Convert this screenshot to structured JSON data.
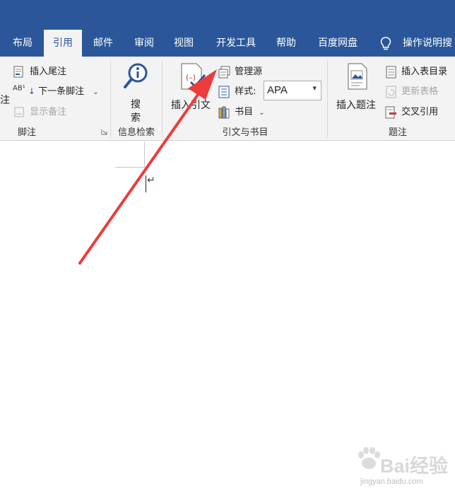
{
  "tabs": [
    {
      "label": "布局"
    },
    {
      "label": "引用"
    },
    {
      "label": "邮件"
    },
    {
      "label": "审阅"
    },
    {
      "label": "视图"
    },
    {
      "label": "开发工具"
    },
    {
      "label": "帮助"
    },
    {
      "label": "百度网盘"
    }
  ],
  "tell_me": "操作说明搜",
  "groups": {
    "footnotes": {
      "label": "脚注",
      "left_partial": "注",
      "insert_endnote": "插入尾注",
      "next_footnote": "下一条脚注",
      "show_notes": "显示备注"
    },
    "research": {
      "label": "信息检索",
      "search_line1": "搜",
      "search_line2": "索"
    },
    "citations": {
      "label": "引文与书目",
      "insert_citation": "插入引文",
      "manage_sources": "管理源",
      "style_label": "样式:",
      "style_value": "APA",
      "bibliography": "书目"
    },
    "captions": {
      "label": "题注",
      "insert_caption": "插入题注",
      "insert_table_of_figures": "插入表目录",
      "update_table": "更新表格",
      "cross_reference": "交叉引用"
    }
  },
  "watermark": {
    "text": "Bai经验",
    "url": "jingyan.baidu.com"
  },
  "colors": {
    "ribbon_blue": "#2b579a",
    "ribbon_bg": "#f3f3f3",
    "annotation_arrow": "#ee3b3b"
  }
}
